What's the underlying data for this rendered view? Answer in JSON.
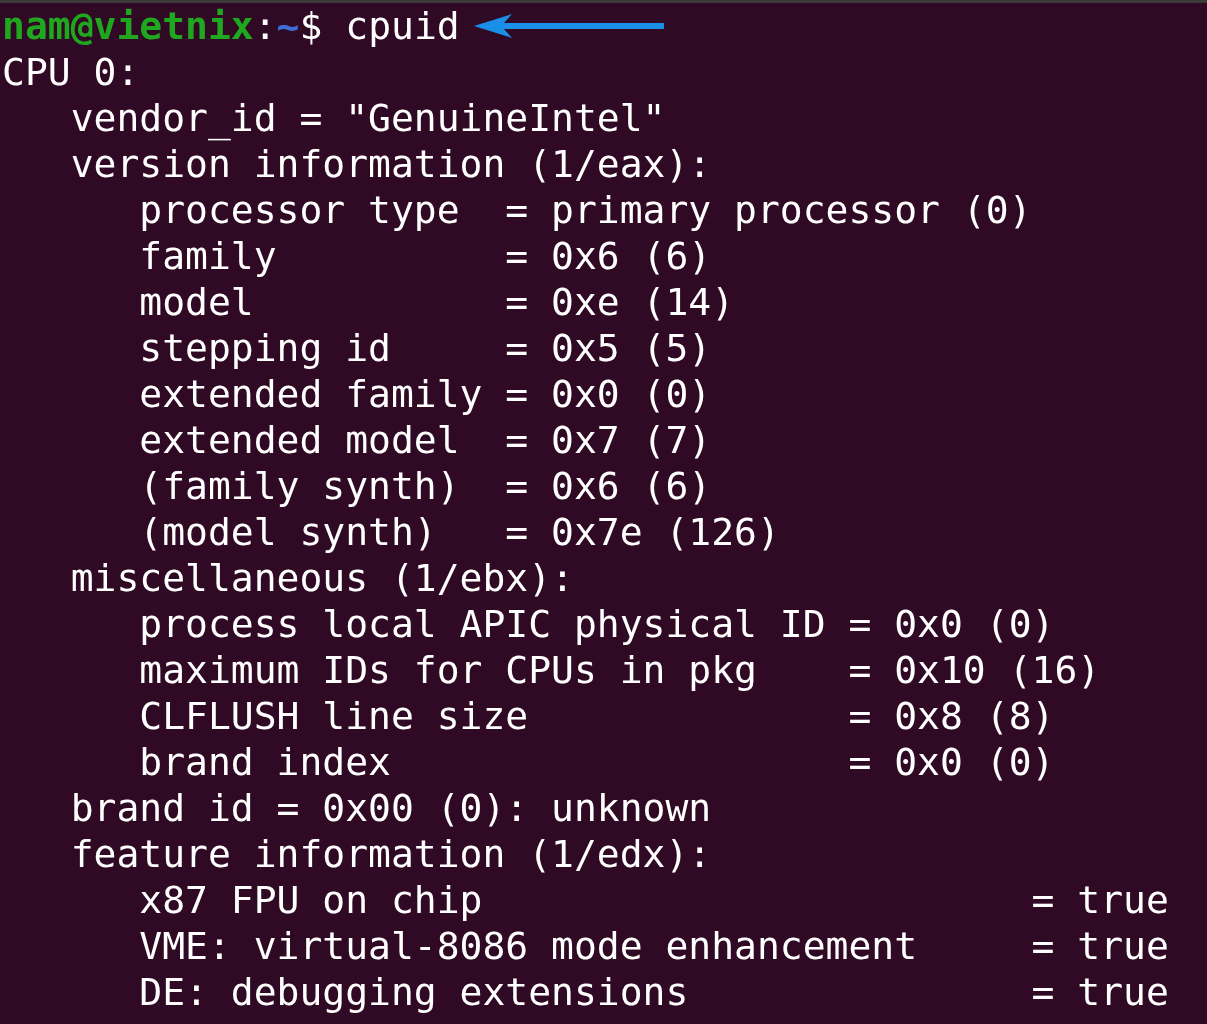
{
  "prompt": {
    "user_host": "nam@vietnix",
    "separator": ":",
    "path": "~",
    "symbol": "$",
    "command": "cpuid"
  },
  "output_lines": [
    "CPU 0:",
    "   vendor_id = \"GenuineIntel\"",
    "   version information (1/eax):",
    "      processor type  = primary processor (0)",
    "      family          = 0x6 (6)",
    "      model           = 0xe (14)",
    "      stepping id     = 0x5 (5)",
    "      extended family = 0x0 (0)",
    "      extended model  = 0x7 (7)",
    "      (family synth)  = 0x6 (6)",
    "      (model synth)   = 0x7e (126)",
    "   miscellaneous (1/ebx):",
    "      process local APIC physical ID = 0x0 (0)",
    "      maximum IDs for CPUs in pkg    = 0x10 (16)",
    "      CLFLUSH line size              = 0x8 (8)",
    "      brand index                    = 0x0 (0)",
    "   brand id = 0x00 (0): unknown",
    "   feature information (1/edx):",
    "      x87 FPU on chip                        = true",
    "      VME: virtual-8086 mode enhancement     = true",
    "      DE: debugging extensions               = true"
  ]
}
